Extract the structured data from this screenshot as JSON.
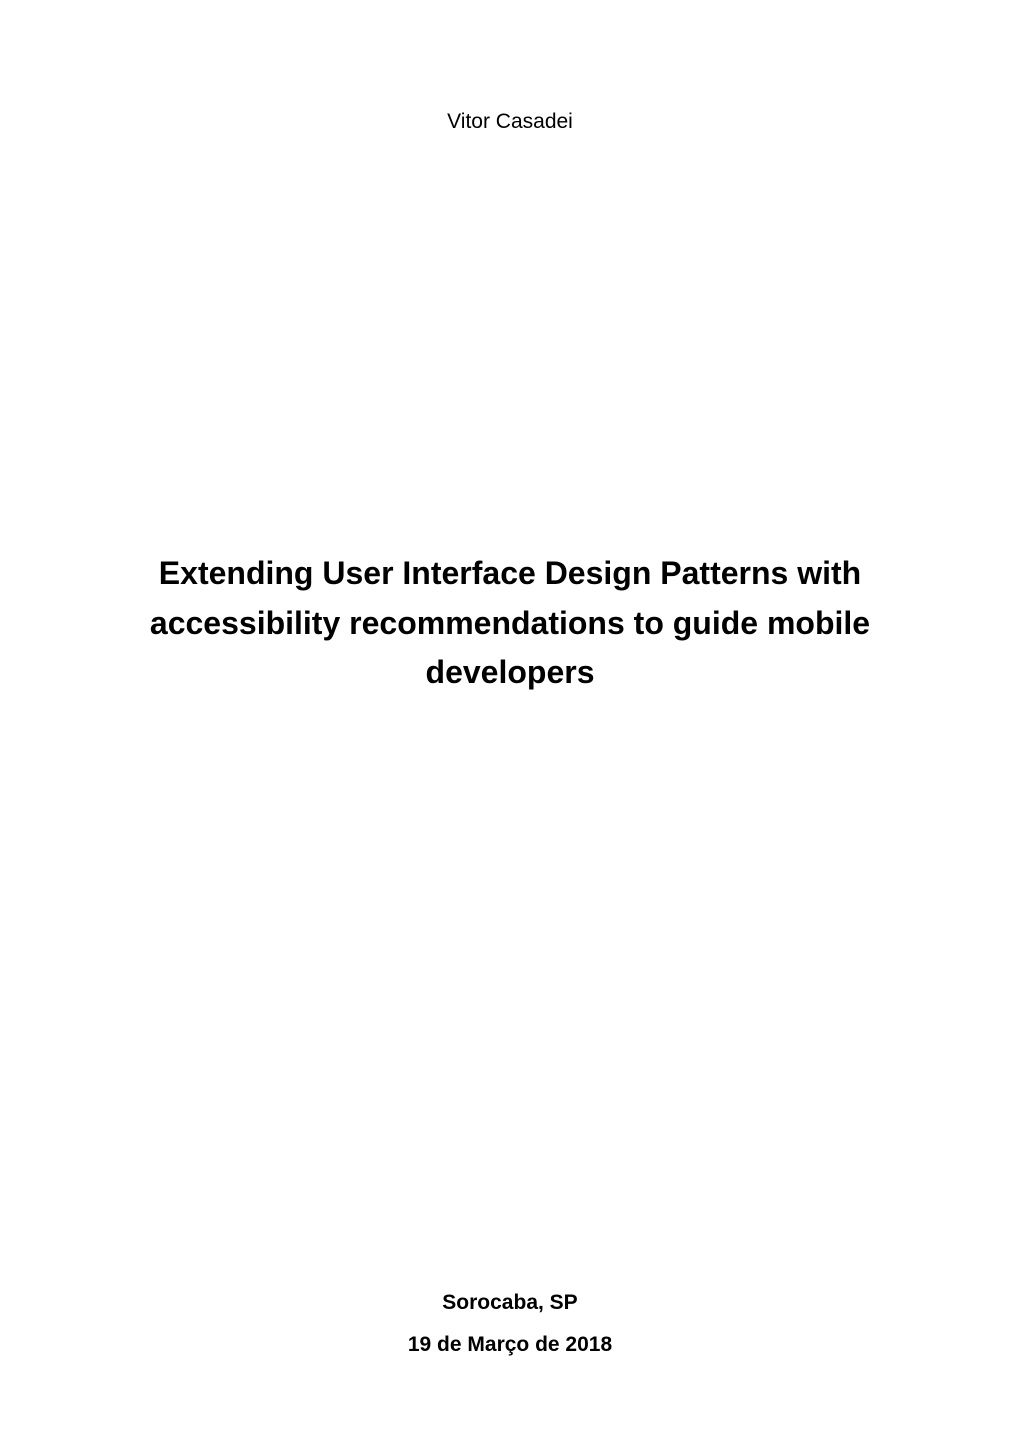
{
  "author": "Vitor Casadei",
  "title": {
    "line1": "Extending User Interface Design Patterns with",
    "line2": "accessibility recommendations to guide mobile",
    "line3": "developers"
  },
  "location": "Sorocaba, SP",
  "date": "19 de Março de 2018"
}
